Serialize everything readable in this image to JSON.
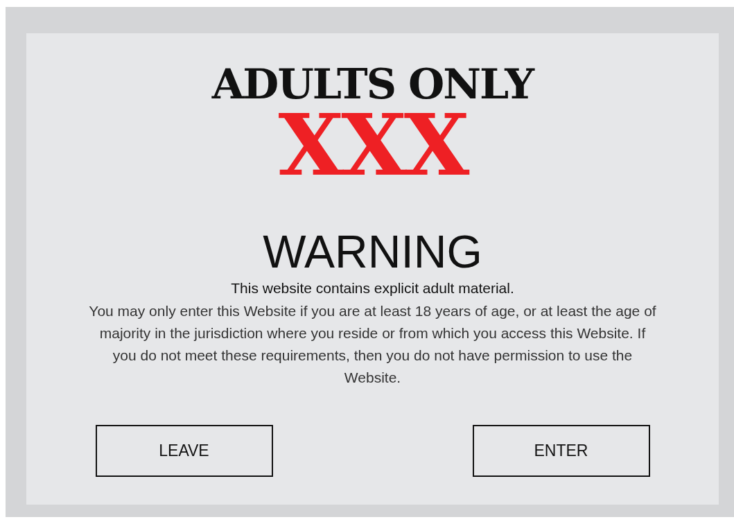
{
  "heading": "ADULTS ONLY",
  "mark": "XXX",
  "warning": {
    "title": "WARNING",
    "lead": "This website contains explicit adult material.",
    "body": "You may only enter this Website if you are at least 18 years of age, or at least the age of majority in the jurisdiction where you reside or from which you access this Website. If you do not meet these requirements, then you do not have permission to use the Website."
  },
  "buttons": [
    {
      "label": "LEAVE"
    },
    {
      "label": "ENTER"
    }
  ]
}
